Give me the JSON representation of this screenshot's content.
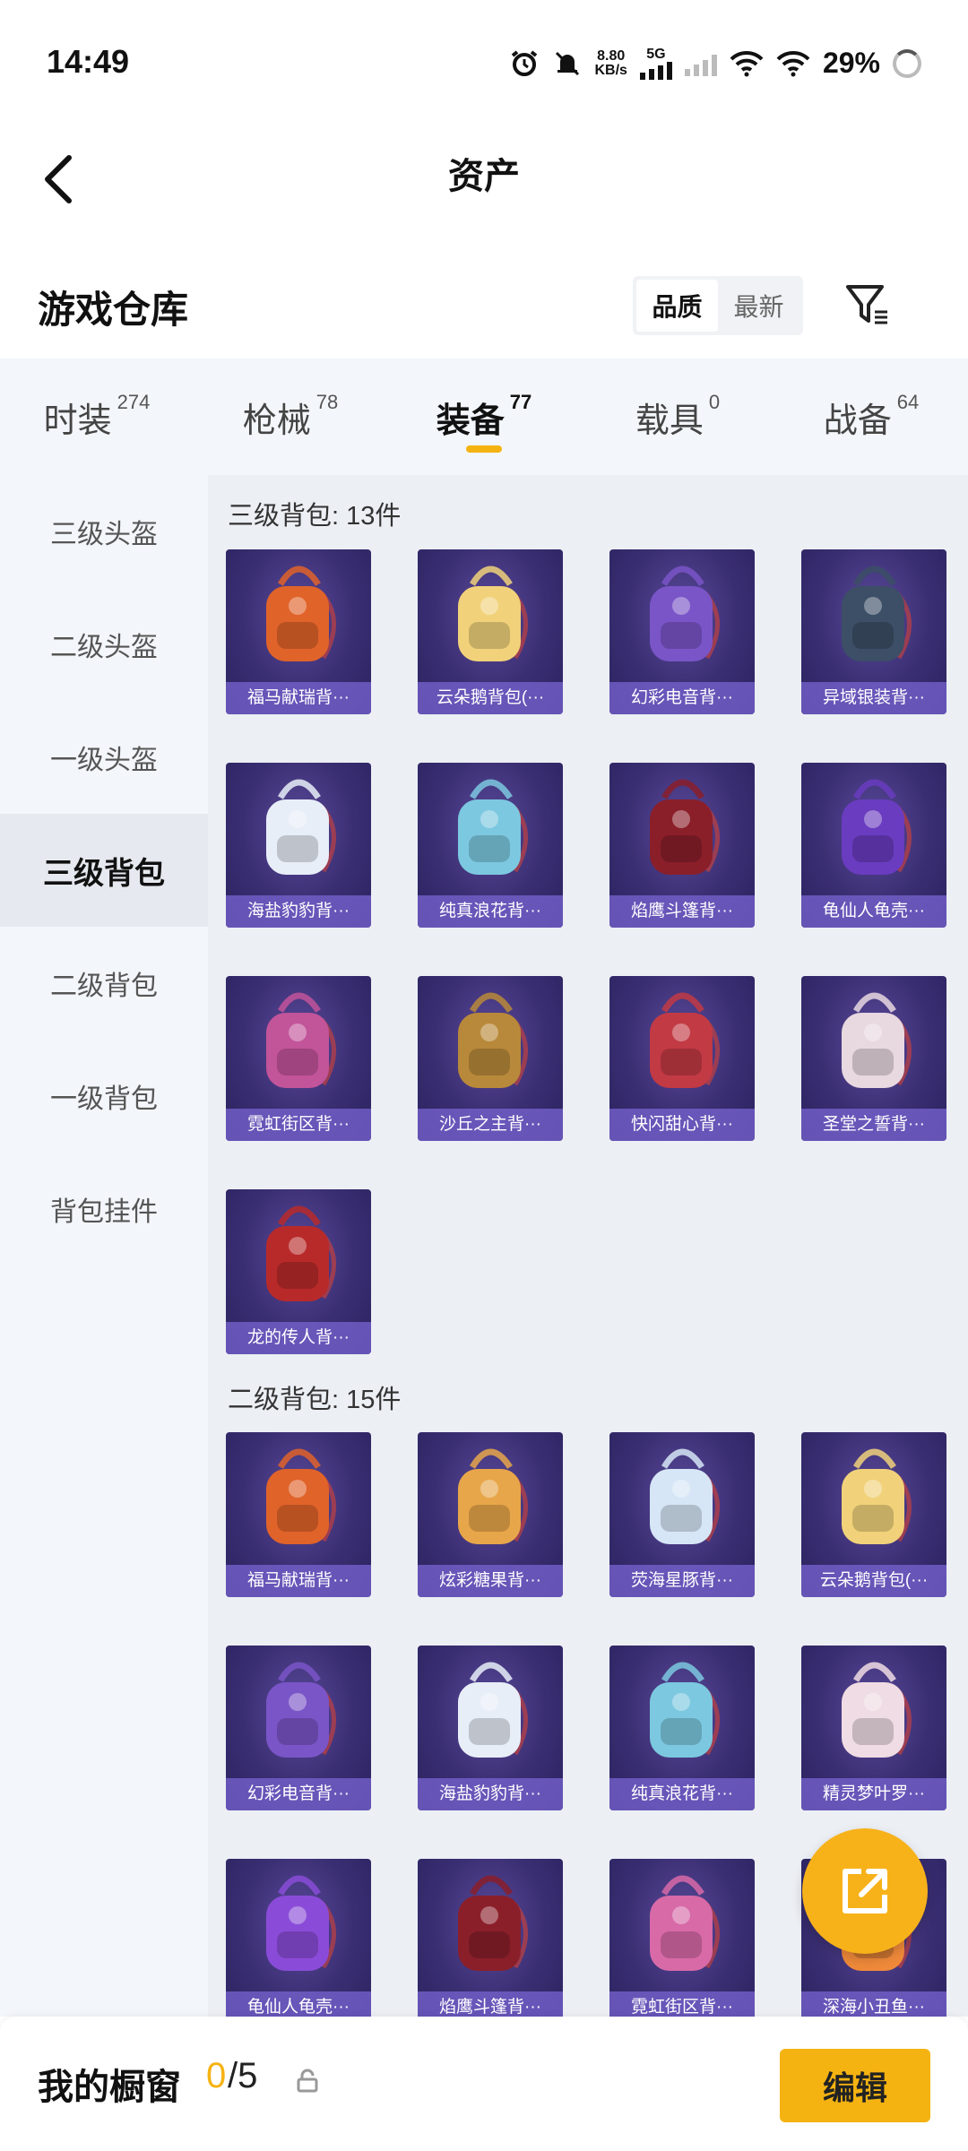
{
  "status_bar": {
    "time": "14:49",
    "net_speed_value": "8.80",
    "net_speed_unit": "KB/s",
    "network_type": "5G",
    "battery": "29%"
  },
  "header": {
    "title": "资产"
  },
  "warehouse": {
    "title": "游戏仓库",
    "sort_options": [
      "品质",
      "最新"
    ],
    "sort_selected": "品质"
  },
  "tabs": [
    {
      "label": "时装",
      "count": "274"
    },
    {
      "label": "枪械",
      "count": "78"
    },
    {
      "label": "装备",
      "count": "77"
    },
    {
      "label": "载具",
      "count": "0"
    },
    {
      "label": "战备",
      "count": "64"
    }
  ],
  "active_tab": "装备",
  "sidebar": [
    {
      "label": "三级头盔"
    },
    {
      "label": "二级头盔"
    },
    {
      "label": "一级头盔"
    },
    {
      "label": "三级背包"
    },
    {
      "label": "二级背包"
    },
    {
      "label": "一级背包"
    },
    {
      "label": "背包挂件"
    }
  ],
  "active_sidebar": "三级背包",
  "sections": [
    {
      "title": "三级背包: 13件",
      "items": [
        {
          "name": "福马献瑞背···",
          "color": "#e0632a"
        },
        {
          "name": "云朵鹅背包(···",
          "color": "#f1d27a"
        },
        {
          "name": "幻彩电音背···",
          "color": "#7a55c8"
        },
        {
          "name": "异域银装背···",
          "color": "#3c4f66"
        },
        {
          "name": "海盐豹豹背···",
          "color": "#e8eef8"
        },
        {
          "name": "纯真浪花背···",
          "color": "#7cc8e0"
        },
        {
          "name": "焰鹰斗篷背···",
          "color": "#8a1f2a"
        },
        {
          "name": "龟仙人龟壳···",
          "color": "#6a3cc0"
        },
        {
          "name": "霓虹街区背···",
          "color": "#c2549a"
        },
        {
          "name": "沙丘之主背···",
          "color": "#b8893a"
        },
        {
          "name": "快闪甜心背···",
          "color": "#c23a44"
        },
        {
          "name": "圣堂之誓背···",
          "color": "#e8d8e0"
        },
        {
          "name": "龙的传人背···",
          "color": "#b82a2a"
        }
      ]
    },
    {
      "title": "二级背包: 15件",
      "items": [
        {
          "name": "福马献瑞背···",
          "color": "#e0632a"
        },
        {
          "name": "炫彩糖果背···",
          "color": "#e8a64a"
        },
        {
          "name": "荧海星豚背···",
          "color": "#d6e6f6"
        },
        {
          "name": "云朵鹅背包(···",
          "color": "#f1d27a"
        },
        {
          "name": "幻彩电音背···",
          "color": "#7a55c8"
        },
        {
          "name": "海盐豹豹背···",
          "color": "#e8eef8"
        },
        {
          "name": "纯真浪花背···",
          "color": "#7cc8e0"
        },
        {
          "name": "精灵梦叶罗···",
          "color": "#f0dce4"
        },
        {
          "name": "龟仙人龟壳···",
          "color": "#8a4cd8"
        },
        {
          "name": "焰鹰斗篷背···",
          "color": "#8a1f2a"
        },
        {
          "name": "霓虹街区背···",
          "color": "#d86aa8"
        },
        {
          "name": "深海小丑鱼···",
          "color": "#f08a3a"
        }
      ]
    }
  ],
  "bottom_bar": {
    "label": "我的橱窗",
    "used": "0",
    "total": "/5",
    "edit_label": "编辑"
  }
}
